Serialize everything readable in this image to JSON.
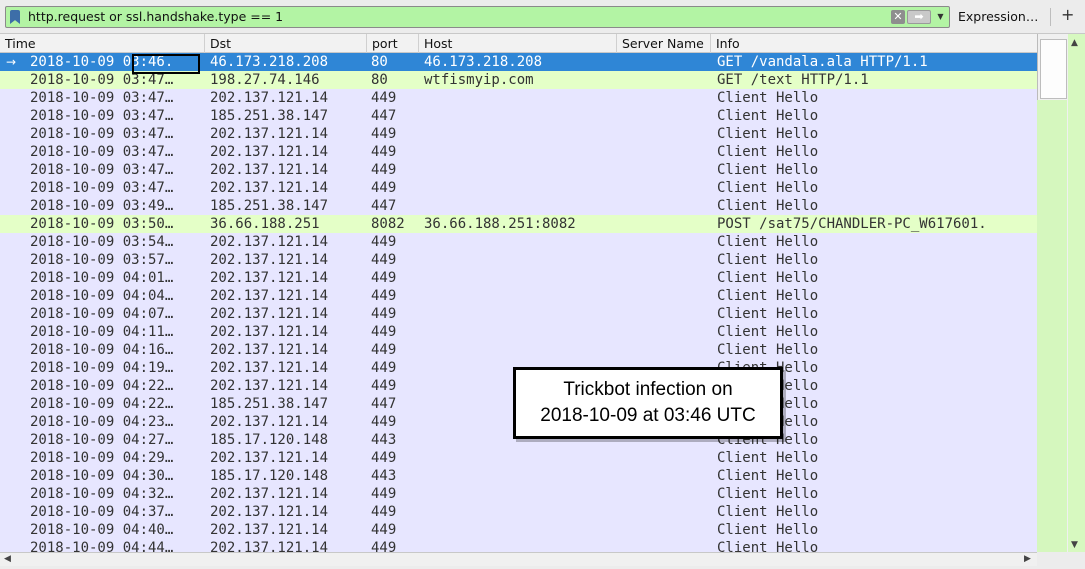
{
  "filter": {
    "text": "http.request or ssl.handshake.type == 1",
    "expression_label": "Expression…",
    "add_label": "+"
  },
  "columns": [
    "Time",
    "Dst",
    "port",
    "Host",
    "Server Name",
    "Info"
  ],
  "rows": [
    {
      "time": "2018-10-09 03:46.",
      "dst": "46.173.218.208",
      "port": "80",
      "host": "46.173.218.208",
      "server": "",
      "info": "GET /vandala.ala HTTP/1.1",
      "kind": "selected"
    },
    {
      "time": "2018-10-09 03:47…",
      "dst": "198.27.74.146",
      "port": "80",
      "host": "wtfismyip.com",
      "server": "",
      "info": "GET /text HTTP/1.1",
      "kind": "http"
    },
    {
      "time": "2018-10-09 03:47…",
      "dst": "202.137.121.14",
      "port": "449",
      "host": "",
      "server": "",
      "info": "Client Hello",
      "kind": "tls"
    },
    {
      "time": "2018-10-09 03:47…",
      "dst": "185.251.38.147",
      "port": "447",
      "host": "",
      "server": "",
      "info": "Client Hello",
      "kind": "tls"
    },
    {
      "time": "2018-10-09 03:47…",
      "dst": "202.137.121.14",
      "port": "449",
      "host": "",
      "server": "",
      "info": "Client Hello",
      "kind": "tls"
    },
    {
      "time": "2018-10-09 03:47…",
      "dst": "202.137.121.14",
      "port": "449",
      "host": "",
      "server": "",
      "info": "Client Hello",
      "kind": "tls"
    },
    {
      "time": "2018-10-09 03:47…",
      "dst": "202.137.121.14",
      "port": "449",
      "host": "",
      "server": "",
      "info": "Client Hello",
      "kind": "tls"
    },
    {
      "time": "2018-10-09 03:47…",
      "dst": "202.137.121.14",
      "port": "449",
      "host": "",
      "server": "",
      "info": "Client Hello",
      "kind": "tls"
    },
    {
      "time": "2018-10-09 03:49…",
      "dst": "185.251.38.147",
      "port": "447",
      "host": "",
      "server": "",
      "info": "Client Hello",
      "kind": "tls"
    },
    {
      "time": "2018-10-09 03:50…",
      "dst": "36.66.188.251",
      "port": "8082",
      "host": "36.66.188.251:8082",
      "server": "",
      "info": "POST /sat75/CHANDLER-PC_W617601.",
      "kind": "http"
    },
    {
      "time": "2018-10-09 03:54…",
      "dst": "202.137.121.14",
      "port": "449",
      "host": "",
      "server": "",
      "info": "Client Hello",
      "kind": "tls"
    },
    {
      "time": "2018-10-09 03:57…",
      "dst": "202.137.121.14",
      "port": "449",
      "host": "",
      "server": "",
      "info": "Client Hello",
      "kind": "tls"
    },
    {
      "time": "2018-10-09 04:01…",
      "dst": "202.137.121.14",
      "port": "449",
      "host": "",
      "server": "",
      "info": "Client Hello",
      "kind": "tls"
    },
    {
      "time": "2018-10-09 04:04…",
      "dst": "202.137.121.14",
      "port": "449",
      "host": "",
      "server": "",
      "info": "Client Hello",
      "kind": "tls"
    },
    {
      "time": "2018-10-09 04:07…",
      "dst": "202.137.121.14",
      "port": "449",
      "host": "",
      "server": "",
      "info": "Client Hello",
      "kind": "tls"
    },
    {
      "time": "2018-10-09 04:11…",
      "dst": "202.137.121.14",
      "port": "449",
      "host": "",
      "server": "",
      "info": "Client Hello",
      "kind": "tls"
    },
    {
      "time": "2018-10-09 04:16…",
      "dst": "202.137.121.14",
      "port": "449",
      "host": "",
      "server": "",
      "info": "Client Hello",
      "kind": "tls"
    },
    {
      "time": "2018-10-09 04:19…",
      "dst": "202.137.121.14",
      "port": "449",
      "host": "",
      "server": "",
      "info": "Client Hello",
      "kind": "tls"
    },
    {
      "time": "2018-10-09 04:22…",
      "dst": "202.137.121.14",
      "port": "449",
      "host": "",
      "server": "",
      "info": "Client Hello",
      "kind": "tls"
    },
    {
      "time": "2018-10-09 04:22…",
      "dst": "185.251.38.147",
      "port": "447",
      "host": "",
      "server": "",
      "info": "Client Hello",
      "kind": "tls"
    },
    {
      "time": "2018-10-09 04:23…",
      "dst": "202.137.121.14",
      "port": "449",
      "host": "",
      "server": "",
      "info": "Client Hello",
      "kind": "tls"
    },
    {
      "time": "2018-10-09 04:27…",
      "dst": "185.17.120.148",
      "port": "443",
      "host": "",
      "server": "",
      "info": "Client Hello",
      "kind": "tls"
    },
    {
      "time": "2018-10-09 04:29…",
      "dst": "202.137.121.14",
      "port": "449",
      "host": "",
      "server": "",
      "info": "Client Hello",
      "kind": "tls"
    },
    {
      "time": "2018-10-09 04:30…",
      "dst": "185.17.120.148",
      "port": "443",
      "host": "",
      "server": "",
      "info": "Client Hello",
      "kind": "tls"
    },
    {
      "time": "2018-10-09 04:32…",
      "dst": "202.137.121.14",
      "port": "449",
      "host": "",
      "server": "",
      "info": "Client Hello",
      "kind": "tls"
    },
    {
      "time": "2018-10-09 04:37…",
      "dst": "202.137.121.14",
      "port": "449",
      "host": "",
      "server": "",
      "info": "Client Hello",
      "kind": "tls"
    },
    {
      "time": "2018-10-09 04:40…",
      "dst": "202.137.121.14",
      "port": "449",
      "host": "",
      "server": "",
      "info": "Client Hello",
      "kind": "tls"
    },
    {
      "time": "2018-10-09 04:44…",
      "dst": "202.137.121.14",
      "port": "449",
      "host": "",
      "server": "",
      "info": "Client Hello",
      "kind": "tls"
    }
  ],
  "callout": {
    "line1": "Trickbot infection on",
    "line2": "2018-10-09 at 03:46 UTC"
  },
  "colors": {
    "filter_valid": "#b3f4a4",
    "row_http": "#e4ffc7",
    "row_tls": "#e7e6ff",
    "row_selected": "#2f86d6"
  }
}
